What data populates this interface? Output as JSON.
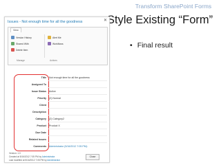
{
  "slide": {
    "header": "Transform SharePoint Forms",
    "title": "Style Existing “Form”",
    "bullet": "Final result"
  },
  "dialog": {
    "title": "Issues - Not enough time for all the goodness",
    "ribbon": {
      "tab": "View",
      "buttons": [
        "Version History",
        "Shared With",
        "Delete Item",
        "Alert Me",
        "Workflows"
      ],
      "groups": [
        "Manage",
        "Actions"
      ]
    },
    "fields": [
      {
        "label": "Title",
        "value": "Not enough time for all the goodness"
      },
      {
        "label": "Assigned To",
        "value": ""
      },
      {
        "label": "Issue Status",
        "value": "Active"
      },
      {
        "label": "Priority",
        "value": "(2) Normal"
      },
      {
        "label": "Client",
        "value": ""
      },
      {
        "label": "Description",
        "value": ""
      },
      {
        "label": "Category",
        "value": "(2) Category2"
      },
      {
        "label": "Product",
        "value": "Product X"
      },
      {
        "label": "Due Date",
        "value": ""
      },
      {
        "label": "Related Issues",
        "value": ""
      },
      {
        "label": "Comments",
        "value": "Administrator (5/16/2012 7:05 PM):"
      }
    ],
    "footer": {
      "version": "Version: 1.0",
      "created_prefix": "Created at 5/16/2012 7:05 PM by",
      "created_by": "Administrator",
      "modified_prefix": "Last modified at 5/16/2012 7:05 PM by",
      "modified_by": "Administrator"
    },
    "close_label": "Close"
  },
  "colors": {
    "header": "#8aa6c9",
    "link": "#1f7ab5",
    "highlight": "#e23030"
  }
}
